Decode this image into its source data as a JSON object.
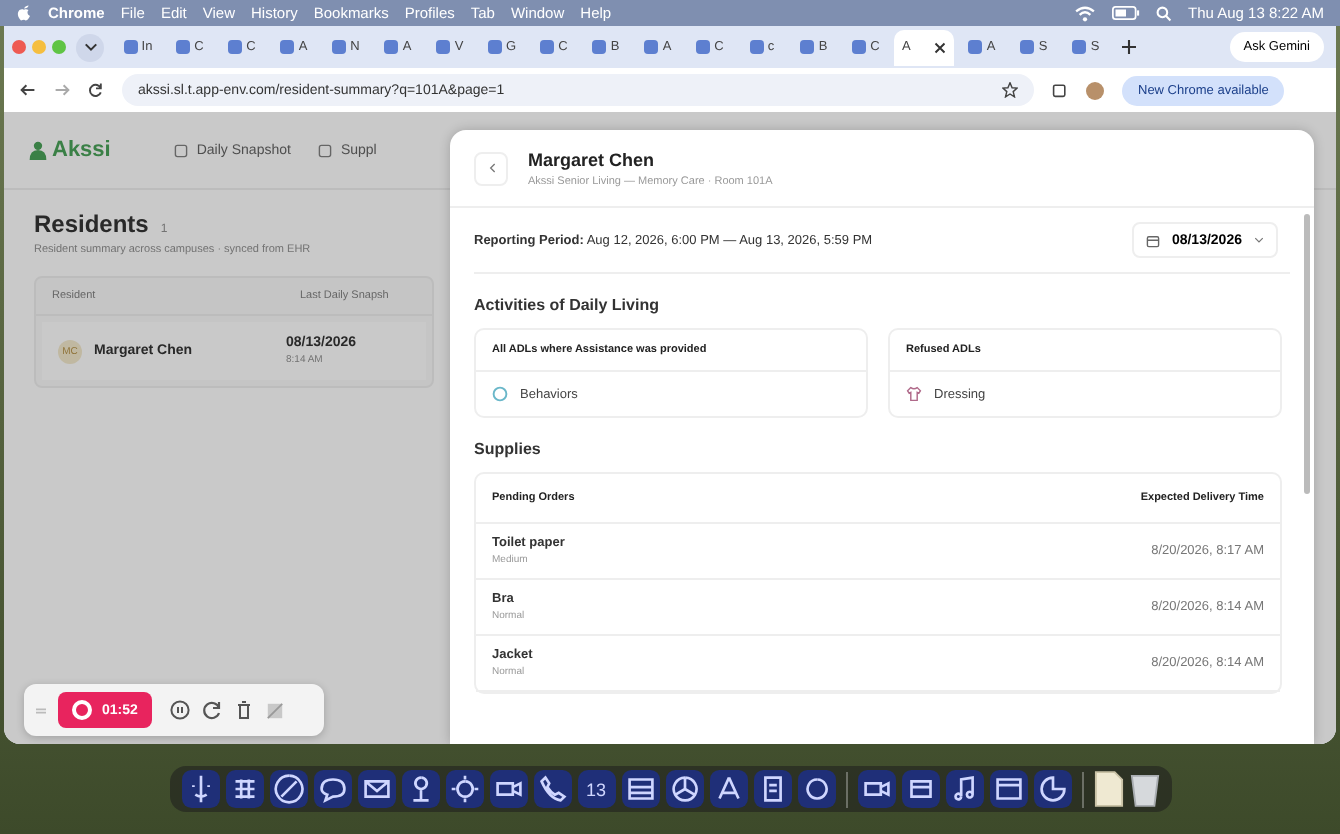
{
  "menubar": {
    "app": "Chrome",
    "items": [
      "File",
      "Edit",
      "View",
      "History",
      "Bookmarks",
      "Profiles",
      "Tab",
      "Window",
      "Help"
    ],
    "clock": "Thu Aug 13  8:22 AM"
  },
  "tabs": [
    {
      "label": "In",
      "selected": false
    },
    {
      "label": "C",
      "selected": false
    },
    {
      "label": "C",
      "selected": false
    },
    {
      "label": "A",
      "selected": false
    },
    {
      "label": "N",
      "selected": false
    },
    {
      "label": "A",
      "selected": false
    },
    {
      "label": "V",
      "selected": false
    },
    {
      "label": "G",
      "selected": false
    },
    {
      "label": "C",
      "selected": false
    },
    {
      "label": "B",
      "selected": false
    },
    {
      "label": "A",
      "selected": false
    },
    {
      "label": "C",
      "selected": false
    },
    {
      "label": "c",
      "selected": false
    },
    {
      "label": "B",
      "selected": false
    },
    {
      "label": "C",
      "selected": false
    },
    {
      "label": "A",
      "selected": true
    },
    {
      "label": "A",
      "selected": false
    },
    {
      "label": "S",
      "selected": false
    },
    {
      "label": "S",
      "selected": false
    }
  ],
  "ask_gemini": "Ask Gemini",
  "address_bar": {
    "url": "akssi.sl.t.app-env.com/resident-summary?q=101A&page=1",
    "update_button": "New Chrome available"
  },
  "app": {
    "logo": "Akssi",
    "nav": [
      "Daily Snapshot",
      "Suppl"
    ],
    "title": "Residents",
    "count": "1",
    "subtitle": "Resident summary across campuses · synced from EHR",
    "columns": [
      "Resident",
      "Last Daily Snapsh"
    ],
    "rows": [
      {
        "initials": "MC",
        "name": "Margaret Chen",
        "date": "08/13/2026",
        "time": "8:14 AM"
      }
    ]
  },
  "modal": {
    "name": "Margaret Chen",
    "subtitle": "Akssi Senior Living — Memory Care · Room 101A",
    "period": "**Reporting Period:** Aug 12, 2026, 6:00 PM — Aug 13, 2026, 5:59 PM",
    "date": "08/13/2026",
    "adl_title": "Activities of Daily Living",
    "adl_cards": [
      {
        "title": "All ADLs where Assistance was provided",
        "items": [
          {
            "label": "Behaviors",
            "kind": "behaviors"
          }
        ]
      },
      {
        "title": "Refused ADLs",
        "items": [
          {
            "label": "Dressing",
            "kind": "dressing"
          }
        ]
      }
    ],
    "supplies_title": "Supplies",
    "supply_columns": [
      "Pending Orders",
      "Expected Delivery Time"
    ],
    "supply_rows": [
      {
        "item": "Toilet paper",
        "priority": "Medium",
        "time": "8/20/2026, 8:17 AM"
      },
      {
        "item": "Bra",
        "priority": "Normal",
        "time": "8/20/2026, 8:14 AM"
      },
      {
        "item": "Jacket",
        "priority": "Normal",
        "time": "8/20/2026, 8:14 AM"
      }
    ]
  },
  "recorder": {
    "time": "01:52"
  },
  "dock": {
    "calendar_day": "13"
  }
}
